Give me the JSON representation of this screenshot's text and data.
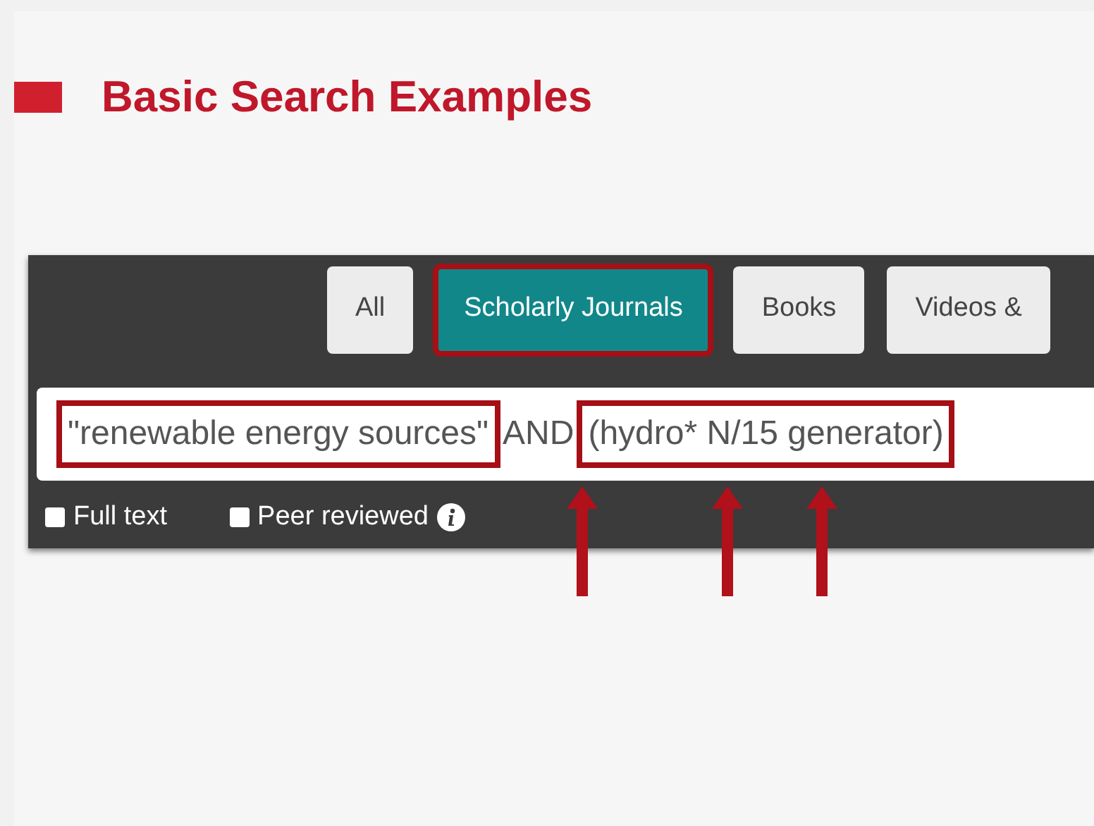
{
  "slide_title": "Basic Search Examples",
  "tabs": [
    {
      "label": "All",
      "selected": false,
      "highlighted": false
    },
    {
      "label": "Scholarly Journals",
      "selected": true,
      "highlighted": true
    },
    {
      "label": "Books",
      "selected": false,
      "highlighted": false
    },
    {
      "label": "Videos &",
      "selected": false,
      "highlighted": false
    }
  ],
  "query_parts": [
    {
      "text": "\"renewable energy sources\"",
      "highlighted": true
    },
    {
      "text": "AND",
      "highlighted": false
    },
    {
      "text": "(hydro* N/15 generator)",
      "highlighted": true
    }
  ],
  "filters": [
    {
      "label": "Full text",
      "checked": false,
      "info": false
    },
    {
      "label": "Peer reviewed",
      "checked": false,
      "info": true
    }
  ]
}
